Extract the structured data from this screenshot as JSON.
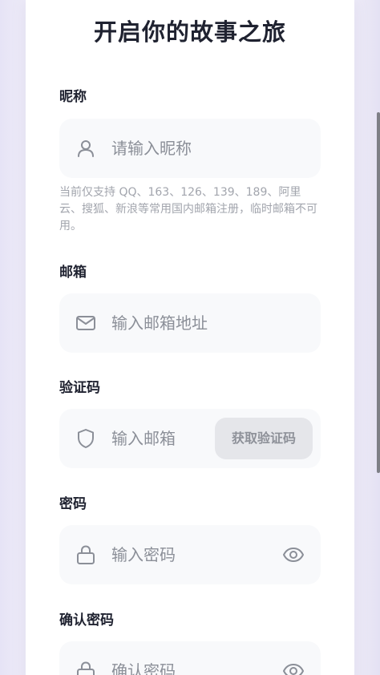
{
  "form": {
    "title": "开启你的故事之旅",
    "nickname": {
      "label": "昵称",
      "placeholder": "请输入昵称",
      "hint": "当前仅支持 QQ、163、126、139、189、阿里云、搜狐、新浪等常用国内邮箱注册，临时邮箱不可用。",
      "icon": "user-icon"
    },
    "email": {
      "label": "邮箱",
      "placeholder": "输入邮箱地址",
      "icon": "mail-icon"
    },
    "code": {
      "label": "验证码",
      "placeholder": "输入邮箱",
      "button": "获取验证码",
      "icon": "shield-icon"
    },
    "password": {
      "label": "密码",
      "placeholder": "输入密码",
      "icon": "lock-icon",
      "toggle_icon": "eye-icon"
    },
    "confirm_password": {
      "label": "确认密码",
      "placeholder": "确认密码",
      "icon": "lock-icon",
      "toggle_icon": "eye-icon"
    }
  },
  "colors": {
    "accent_text": "#1f2230",
    "field_bg": "#f8f9fb",
    "placeholder": "#8b8f98",
    "button_bg": "#e5e6ea"
  }
}
